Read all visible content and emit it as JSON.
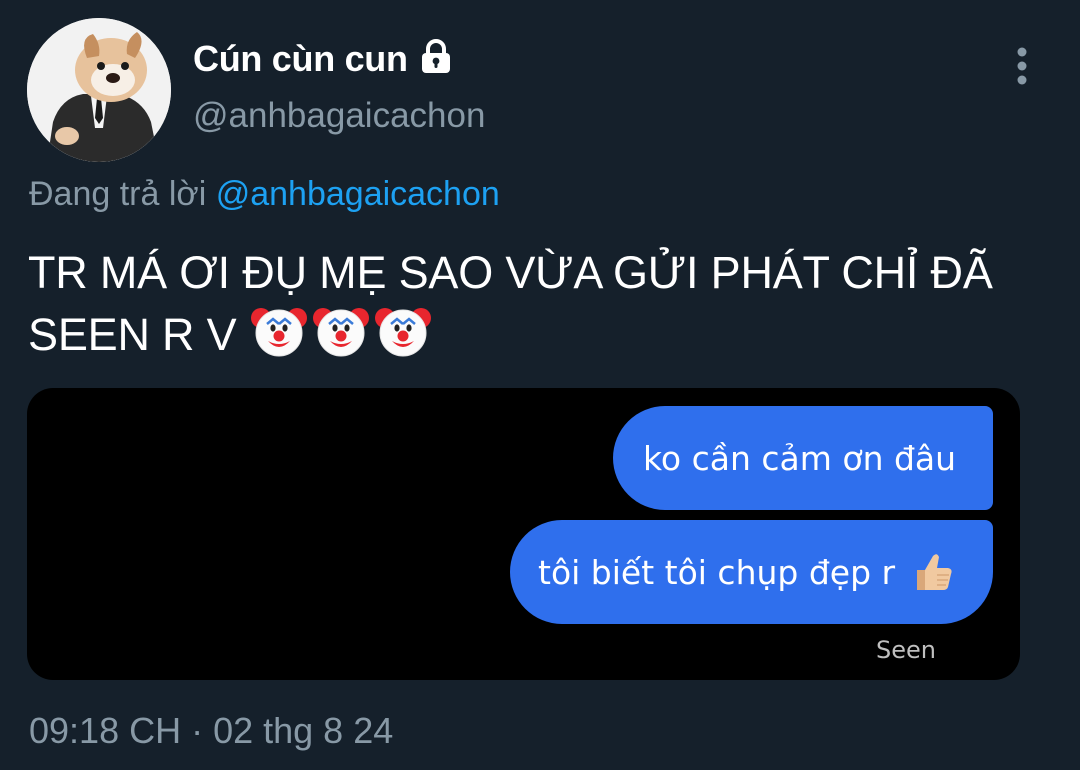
{
  "author": {
    "display_name": "Cún cùn cun",
    "handle": "@anhbagaicachon",
    "avatar_icon": "dog-in-suit-avatar",
    "protected_icon": "lock-icon"
  },
  "header": {
    "more_icon": "more-vertical-icon"
  },
  "reply_context": {
    "prefix": "Đang trả lời",
    "mention": "@anhbagaicachon"
  },
  "tweet": {
    "text": "TR MÁ ƠI ĐỤ MẸ SAO VỪA GỬI PHÁT CHỈ ĐÃ SEEN R V",
    "emojis": [
      "clown-face-emoji",
      "clown-face-emoji",
      "clown-face-emoji"
    ]
  },
  "media": {
    "messages": [
      {
        "text": "ko cần cảm ơn đâu"
      },
      {
        "text": "tôi biết tôi chụp đẹp r",
        "emoji": "thumbs-up-emoji"
      }
    ],
    "status_text": "Seen",
    "bubble_color": "#2f6fed"
  },
  "timestamp": "09:18 CH · 02 thg 8 24",
  "colors": {
    "background": "#15202b",
    "secondary_text": "#8899a6",
    "link": "#1da1f2"
  }
}
